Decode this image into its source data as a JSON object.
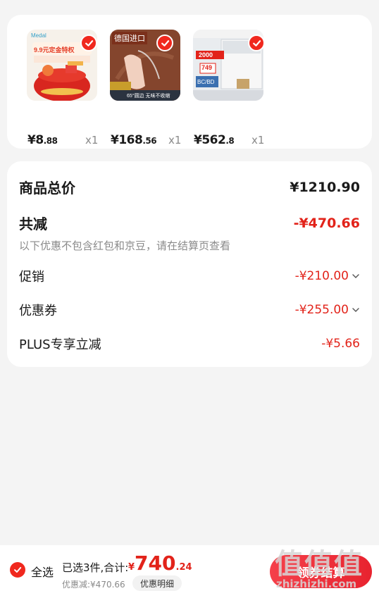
{
  "products": [
    {
      "name": "Medal 9.9元定金特权",
      "price_int": "¥8",
      "price_dec": ".88",
      "qty": "x1"
    },
    {
      "name": "德国进口 桌布",
      "price_int": "¥168",
      "price_dec": ".56",
      "qty": "x1"
    },
    {
      "name": "冷柜",
      "price_int": "¥562",
      "price_dec": ".8",
      "qty": "x1"
    }
  ],
  "product_thumb_texts": {
    "p1_brand": "Medal",
    "p1_banner": "9.9元定金特权",
    "p2_banner": "德国进口",
    "p2_footer": "65°圆边 无味不收缩",
    "p3_price": "749",
    "p3_promo": "2000",
    "p3_model": "BC/BD"
  },
  "summary": {
    "total_label": "商品总价",
    "total_value": "¥1210.90",
    "reduce_label": "共减",
    "reduce_value": "-¥470.66",
    "note": "以下优惠不包含红包和京豆，请在结算页查看",
    "rows": [
      {
        "label": "促销",
        "value": "-¥210.00",
        "expandable": true
      },
      {
        "label": "优惠券",
        "value": "-¥255.00",
        "expandable": true
      },
      {
        "label": "PLUS专享立减",
        "value": "-¥5.66",
        "expandable": false
      }
    ]
  },
  "bottom": {
    "select_all": "全选",
    "selected_text": "已选3件,合计:",
    "total_symbol": "¥",
    "total_int": "740",
    "total_dec": ".24",
    "discount_text": "优惠减:¥470.66",
    "detail_button": "优惠明细",
    "checkout_button": "领券结算"
  },
  "watermark": {
    "top": "值值值",
    "bottom": "zhizhizhi.com"
  },
  "colors": {
    "accent": "#e2231a",
    "check": "#f0281e",
    "background": "#f4f4f4"
  }
}
